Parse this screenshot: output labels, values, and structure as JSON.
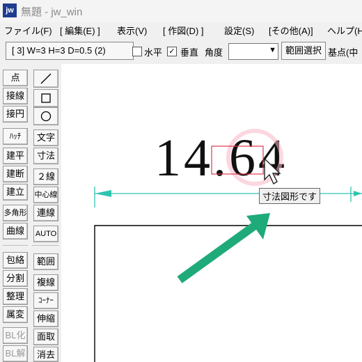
{
  "window": {
    "app_icon": "jw",
    "title": "無題 - jw_win"
  },
  "menu": [
    "ファイル(F)",
    "[ 編集(E) ]",
    "表示(V)",
    "[ 作図(D) ]",
    "設定(S)",
    "[その他(A)]",
    "ヘルプ(H"
  ],
  "toolbar": {
    "layer_spec": "[ 3]  W=3  H=3  D=0.5 (2)",
    "horizontal_label": "水平",
    "vertical_label": "垂直",
    "vertical_checked": "✓",
    "angle_label": "角度",
    "angle_value": "",
    "range_select_button": "範囲選択",
    "base_point_label": "基点(中"
  },
  "left_palette_a": [
    "点",
    "接線",
    "接円",
    "ﾊｯﾁ",
    "建平",
    "建断",
    "建立",
    "多角形",
    "曲線",
    "包絡",
    "分割",
    "整理",
    "属変",
    "BL化",
    "BL解"
  ],
  "left_palette_b": [
    "文字",
    "寸法",
    "２線",
    "中心線",
    "連線",
    "AUTO",
    "範囲",
    "複線",
    "ｺｰﾅｰ",
    "伸縮",
    "面取",
    "消去"
  ],
  "left_palette_b_icons": [
    "line-tool-icon",
    "rectangle-tool-icon",
    "circle-tool-icon"
  ],
  "canvas": {
    "dimension_text": "14.64",
    "tooltip": "寸法図形です"
  },
  "colors": {
    "accent_teal": "#2ec4b0",
    "arrow_green": "#1faa7a",
    "highlight_red": "#e03a50",
    "highlight_pink": "#f7b6c4"
  }
}
